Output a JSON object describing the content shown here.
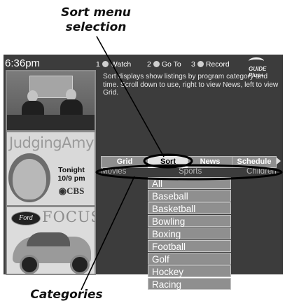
{
  "annotations": {
    "sort_caption_line1": "Sort menu",
    "sort_caption_line2": "selection",
    "categories_caption": "Categories"
  },
  "header": {
    "clock": "6:36pm",
    "quick_keys": [
      {
        "num": "1",
        "label": "Watch"
      },
      {
        "num": "2",
        "label": "Go To"
      },
      {
        "num": "3",
        "label": "Record"
      }
    ],
    "logo_text": "GUIDE Plus+"
  },
  "description": "Sort displays show listings by program category and time. Scroll down to use, right to view News, left to view Grid.",
  "promos": {
    "show_title": "JudgingAmy",
    "show_tonight": "Tonight",
    "show_time": "10/9 pm",
    "show_network": "◉CBS",
    "car_brand": "Ford",
    "car_model": "FOCUS"
  },
  "tabs": [
    {
      "label": "Grid",
      "active": false
    },
    {
      "label": "Sort",
      "active": true
    },
    {
      "label": "News",
      "active": false
    },
    {
      "label": "Schedule",
      "active": false
    }
  ],
  "category_bar": [
    "Movies",
    "Sports",
    "Children"
  ],
  "categories": [
    "All",
    "Baseball",
    "Basketball",
    "Bowling",
    "Boxing",
    "Football",
    "Golf",
    "Hockey",
    "Racing"
  ]
}
